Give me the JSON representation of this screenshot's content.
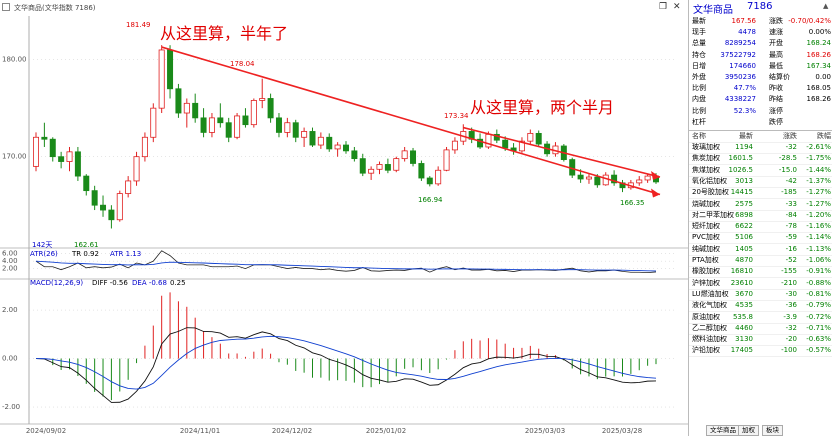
{
  "window": {
    "title": "文华商品(文华指数 7186)",
    "controls": {
      "restore": "❐",
      "close": "✕"
    }
  },
  "annotations": {
    "note1": "从这里算，半年了",
    "note2": "从这里算，两个半月"
  },
  "price_labels": {
    "high1": "181.49",
    "high2": "178.04",
    "high3": "173.34",
    "low1": "166.94",
    "low2": "166.35",
    "low0": "162.61"
  },
  "days_label": "142天",
  "atr_legend": {
    "name": "ATR(26)",
    "tr": "TR 0.92",
    "atr": "ATR 1.13"
  },
  "macd_legend": {
    "name": "MACD(12,26,9)",
    "diff": "DIFF -0.56",
    "dea": "DEA -0.68",
    "macd": "0.25"
  },
  "colors": {
    "up": "#e02020",
    "down": "#1a8a1a",
    "arrow": "#ee2222"
  },
  "chart_data": {
    "type": "candlestick",
    "x_labels": [
      "2024/09/02",
      "2024/11/01",
      "2024/12/02",
      "2025/01/02",
      "2025/03/03",
      "2025/03/28"
    ],
    "y_ticks_main": [
      "180.00",
      "170.00"
    ],
    "y_ticks_atr": [
      "6.00",
      "4.00",
      "2.00"
    ],
    "y_ticks_macd": [
      "2.00",
      "0.00",
      "-2.00"
    ],
    "ylim_main": [
      161,
      184.5
    ],
    "ylim_atr": [
      0,
      7
    ],
    "ylim_macd": [
      -2.7,
      3.2
    ],
    "candles": [
      [
        169.0,
        172.5,
        168.5,
        172.0
      ],
      [
        172.0,
        173.5,
        171.0,
        171.8
      ],
      [
        171.8,
        172.0,
        169.5,
        170.0
      ],
      [
        170.0,
        170.5,
        168.8,
        169.5
      ],
      [
        169.5,
        171.0,
        168.5,
        170.5
      ],
      [
        170.5,
        171.0,
        167.5,
        168.0
      ],
      [
        168.0,
        168.2,
        166.0,
        166.5
      ],
      [
        166.5,
        167.0,
        164.5,
        165.0
      ],
      [
        165.0,
        166.0,
        163.8,
        164.5
      ],
      [
        164.5,
        165.0,
        162.6,
        163.5
      ],
      [
        163.5,
        166.5,
        163.3,
        166.2
      ],
      [
        166.2,
        168.0,
        165.8,
        167.5
      ],
      [
        167.5,
        170.5,
        167.0,
        170.0
      ],
      [
        170.0,
        172.5,
        169.5,
        172.0
      ],
      [
        172.0,
        175.5,
        171.5,
        175.0
      ],
      [
        175.0,
        181.5,
        174.5,
        181.0
      ],
      [
        181.0,
        181.49,
        176.0,
        177.0
      ],
      [
        177.0,
        177.5,
        174.0,
        174.5
      ],
      [
        174.5,
        176.0,
        173.0,
        175.5
      ],
      [
        175.5,
        176.5,
        173.5,
        174.0
      ],
      [
        174.0,
        175.0,
        172.0,
        172.5
      ],
      [
        172.5,
        174.5,
        172.0,
        174.0
      ],
      [
        174.0,
        175.5,
        173.0,
        173.5
      ],
      [
        173.5,
        174.0,
        171.5,
        172.0
      ],
      [
        172.0,
        174.5,
        171.8,
        174.2
      ],
      [
        174.2,
        175.0,
        173.0,
        173.3
      ],
      [
        173.3,
        176.0,
        173.0,
        175.8
      ],
      [
        175.8,
        178.04,
        175.0,
        176.0
      ],
      [
        176.0,
        176.5,
        173.5,
        174.0
      ],
      [
        174.0,
        174.5,
        172.0,
        172.5
      ],
      [
        172.5,
        174.0,
        172.0,
        173.5
      ],
      [
        173.5,
        173.8,
        171.5,
        172.0
      ],
      [
        172.0,
        173.0,
        171.0,
        172.6
      ],
      [
        172.6,
        173.0,
        171.0,
        171.2
      ],
      [
        171.2,
        172.5,
        170.8,
        172.0
      ],
      [
        172.0,
        172.4,
        170.5,
        170.8
      ],
      [
        170.8,
        171.5,
        170.0,
        171.2
      ],
      [
        171.2,
        171.6,
        170.3,
        170.6
      ],
      [
        170.6,
        171.0,
        169.5,
        169.8
      ],
      [
        169.8,
        170.3,
        168.0,
        168.3
      ],
      [
        168.3,
        169.0,
        167.6,
        168.7
      ],
      [
        168.7,
        169.5,
        168.2,
        169.2
      ],
      [
        169.2,
        169.8,
        168.3,
        168.6
      ],
      [
        168.6,
        170.0,
        168.4,
        169.8
      ],
      [
        169.8,
        171.0,
        169.5,
        170.6
      ],
      [
        170.6,
        170.9,
        169.0,
        169.3
      ],
      [
        169.3,
        169.6,
        167.5,
        167.8
      ],
      [
        167.8,
        168.0,
        166.94,
        167.2
      ],
      [
        167.2,
        169.0,
        167.0,
        168.6
      ],
      [
        168.6,
        171.0,
        168.5,
        170.7
      ],
      [
        170.7,
        172.0,
        170.3,
        171.6
      ],
      [
        171.6,
        173.34,
        171.2,
        172.6
      ],
      [
        172.6,
        173.0,
        171.4,
        171.8
      ],
      [
        171.8,
        172.4,
        170.8,
        171.0
      ],
      [
        171.0,
        172.6,
        170.8,
        172.3
      ],
      [
        172.3,
        172.8,
        171.4,
        171.7
      ],
      [
        171.7,
        172.1,
        170.6,
        170.9
      ],
      [
        170.9,
        171.4,
        170.2,
        170.6
      ],
      [
        170.6,
        172.0,
        170.4,
        171.6
      ],
      [
        171.6,
        172.8,
        171.2,
        172.4
      ],
      [
        172.4,
        172.7,
        171.0,
        171.3
      ],
      [
        171.3,
        171.6,
        170.0,
        170.3
      ],
      [
        170.3,
        171.5,
        170.0,
        171.1
      ],
      [
        171.1,
        171.3,
        169.5,
        169.7
      ],
      [
        169.7,
        169.9,
        167.8,
        168.1
      ],
      [
        168.1,
        168.7,
        167.3,
        167.7
      ],
      [
        167.7,
        168.3,
        167.2,
        167.9
      ],
      [
        167.9,
        168.2,
        166.8,
        167.1
      ],
      [
        167.1,
        168.4,
        167.0,
        168.1
      ],
      [
        168.1,
        168.6,
        167.0,
        167.3
      ],
      [
        167.3,
        167.6,
        166.35,
        166.8
      ],
      [
        166.8,
        167.6,
        166.6,
        167.3
      ],
      [
        167.3,
        168.0,
        167.0,
        167.6
      ],
      [
        167.6,
        168.2,
        167.3,
        168.0
      ],
      [
        168.0,
        168.3,
        167.2,
        167.4
      ]
    ]
  },
  "panel": {
    "title": "文华商品",
    "code": "7186",
    "quote_rows": [
      {
        "l1": "最新",
        "v1": "167.56",
        "c1": "red",
        "l2": "涨跌",
        "v2": "-0.70/0.42%",
        "c2": "red"
      },
      {
        "l1": "现手",
        "v1": "4478",
        "c1": "blue",
        "l2": "速涨",
        "v2": "0.00%",
        "c2": "blk"
      },
      {
        "l1": "总量",
        "v1": "8289254",
        "c1": "blue",
        "l2": "开盘",
        "v2": "168.24",
        "c2": "green"
      },
      {
        "l1": "持仓",
        "v1": "37522792",
        "c1": "blue",
        "l2": "最高",
        "v2": "168.26",
        "c2": "red"
      },
      {
        "l1": "日增",
        "v1": "174660",
        "c1": "blue",
        "l2": "最低",
        "v2": "167.34",
        "c2": "green"
      },
      {
        "l1": "外盘",
        "v1": "3950236",
        "c1": "blue",
        "l2": "结算价",
        "v2": "0.00",
        "c2": "blk"
      },
      {
        "l1": "比例",
        "v1": "47.7%",
        "c1": "blue",
        "l2": "昨收",
        "v2": "168.05",
        "c2": "blk"
      },
      {
        "l1": "内盘",
        "v1": "4338227",
        "c1": "blue",
        "l2": "昨结",
        "v2": "168.26",
        "c2": "blk"
      },
      {
        "l1": "比例",
        "v1": "52.3%",
        "c1": "blue",
        "l2": "涨停",
        "v2": "",
        "c2": "blk"
      },
      {
        "l1": "杠杆",
        "v1": "",
        "c1": "blk",
        "l2": "跌停",
        "v2": "",
        "c2": "blk"
      }
    ],
    "watch_header": {
      "name": "名称",
      "last": "最新",
      "chg": "涨跌",
      "pct": "跌幅"
    },
    "watch_rows": [
      {
        "name": "玻璃加权",
        "last": "1194",
        "chg": "-32",
        "pct": "-2.61%"
      },
      {
        "name": "焦炭加权",
        "last": "1601.5",
        "chg": "-28.5",
        "pct": "-1.75%"
      },
      {
        "name": "焦煤加权",
        "last": "1026.5",
        "chg": "-15.0",
        "pct": "-1.44%"
      },
      {
        "name": "氧化铝加权",
        "last": "3013",
        "chg": "-42",
        "pct": "-1.37%"
      },
      {
        "name": "20号胶加权",
        "last": "14415",
        "chg": "-185",
        "pct": "-1.27%"
      },
      {
        "name": "烧碱加权",
        "last": "2575",
        "chg": "-33",
        "pct": "-1.27%"
      },
      {
        "name": "对二甲苯加权",
        "last": "6898",
        "chg": "-84",
        "pct": "-1.20%"
      },
      {
        "name": "短纤加权",
        "last": "6622",
        "chg": "-78",
        "pct": "-1.16%"
      },
      {
        "name": "PVC加权",
        "last": "5106",
        "chg": "-59",
        "pct": "-1.14%"
      },
      {
        "name": "纯碱加权",
        "last": "1405",
        "chg": "-16",
        "pct": "-1.13%"
      },
      {
        "name": "PTA加权",
        "last": "4870",
        "chg": "-52",
        "pct": "-1.06%"
      },
      {
        "name": "橡胶加权",
        "last": "16810",
        "chg": "-155",
        "pct": "-0.91%"
      },
      {
        "name": "沪锌加权",
        "last": "23610",
        "chg": "-210",
        "pct": "-0.88%"
      },
      {
        "name": "LU燃油加权",
        "last": "3670",
        "chg": "-30",
        "pct": "-0.81%"
      },
      {
        "name": "液化气加权",
        "last": "4535",
        "chg": "-36",
        "pct": "-0.79%"
      },
      {
        "name": "原油加权",
        "last": "535.8",
        "chg": "-3.9",
        "pct": "-0.72%"
      },
      {
        "name": "乙二醇加权",
        "last": "4460",
        "chg": "-32",
        "pct": "-0.71%"
      },
      {
        "name": "燃料油加权",
        "last": "3130",
        "chg": "-20",
        "pct": "-0.63%"
      },
      {
        "name": "沪铅加权",
        "last": "17405",
        "chg": "-100",
        "pct": "-0.57%"
      }
    ],
    "tabs": [
      "文华商品",
      "加权",
      "板块"
    ]
  }
}
